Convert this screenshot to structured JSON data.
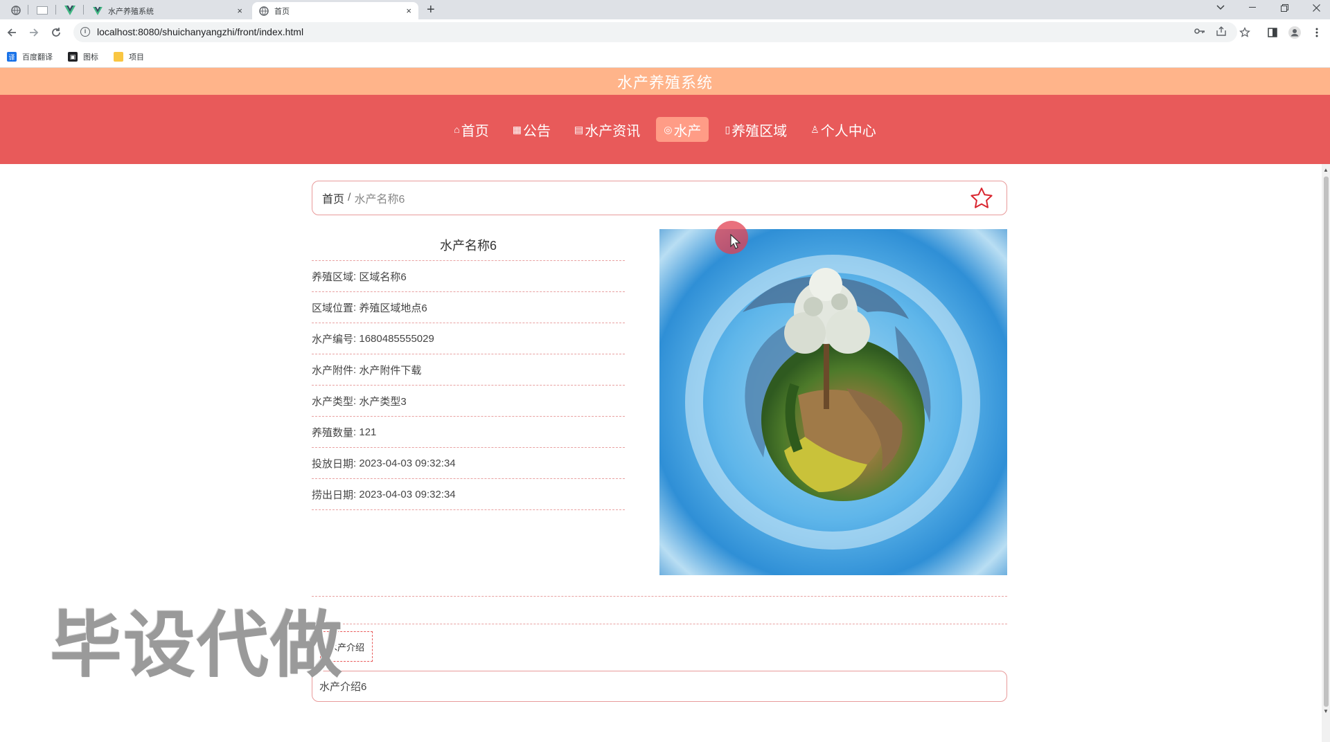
{
  "browser": {
    "tabs": [
      {
        "title": "水产养殖系统",
        "active": false
      },
      {
        "title": "首页",
        "active": true
      }
    ],
    "tab_close_glyph": "×",
    "new_tab_glyph": "+",
    "url": "localhost:8080/shuichanyangzhi/front/index.html",
    "bookmarks": [
      {
        "label": "百度翻译",
        "icon": "translate-icon",
        "icon_glyph": "译",
        "color": "#1a73e8"
      },
      {
        "label": "图标",
        "icon": "image-icon",
        "icon_glyph": "▣",
        "color": "#202124"
      },
      {
        "label": "项目",
        "icon": "folder-icon",
        "icon_glyph": "",
        "color": "#f9c642"
      }
    ]
  },
  "site": {
    "title": "水产养殖系统",
    "nav": [
      {
        "icon": "home-icon",
        "glyph": "⌂",
        "label": "首页",
        "active": false
      },
      {
        "icon": "notice-icon",
        "glyph": "▦",
        "label": "公告",
        "active": false
      },
      {
        "icon": "grid-icon",
        "glyph": "▤",
        "label": "水产资讯",
        "active": false
      },
      {
        "icon": "fish-icon",
        "glyph": "◎",
        "label": "水产",
        "active": true
      },
      {
        "icon": "area-icon",
        "glyph": "▯",
        "label": "养殖区域",
        "active": false
      },
      {
        "icon": "user-icon",
        "glyph": "♙",
        "label": "个人中心",
        "active": false
      }
    ]
  },
  "breadcrumb": {
    "home": "首页",
    "separator": "/",
    "current": "水产名称6"
  },
  "detail": {
    "title": "水产名称6",
    "rows": [
      {
        "label": "养殖区域",
        "value": "区域名称6"
      },
      {
        "label": "区域位置",
        "value": "养殖区域地点6"
      },
      {
        "label": "水产编号",
        "value": "1680485555029"
      },
      {
        "label": "水产附件",
        "value": "水产附件下载"
      },
      {
        "label": "水产类型",
        "value": "水产类型3"
      },
      {
        "label": "养殖数量",
        "value": "121"
      },
      {
        "label": "投放日期",
        "value": "2023-04-03 09:32:34"
      },
      {
        "label": "捞出日期",
        "value": "2023-04-03 09:32:34"
      }
    ]
  },
  "intro": {
    "tab_label": "水产介绍",
    "content": "水产介绍6"
  },
  "watermark": "毕设代做",
  "colors": {
    "title_bar": "#ffb48a",
    "nav_bar": "#e85a5a",
    "nav_active": "#ff9c86",
    "border_accent": "#e89a9a"
  }
}
